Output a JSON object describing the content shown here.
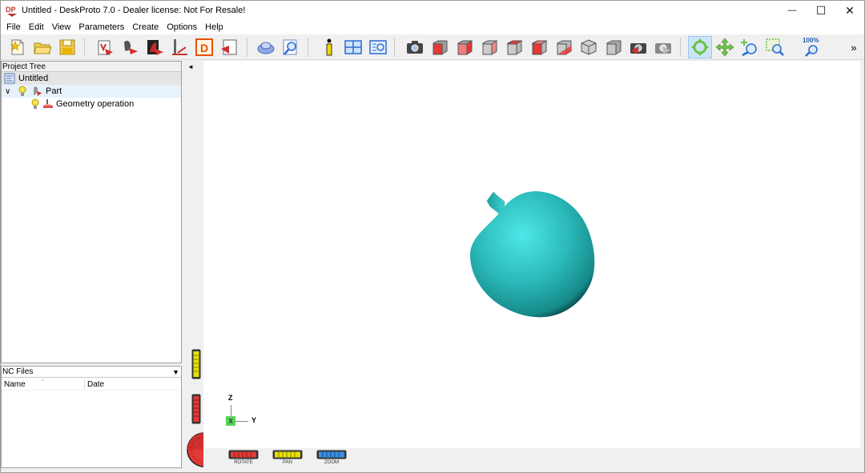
{
  "window": {
    "title": "Untitled - DeskProto 7.0 - Dealer license: Not For Resale!",
    "app_icon_text": "DP",
    "minimize_glyph": "—",
    "maximize_glyph": "☐",
    "close_glyph": "✕"
  },
  "menu": {
    "items": [
      "File",
      "Edit",
      "View",
      "Parameters",
      "Create",
      "Options",
      "Help"
    ]
  },
  "toolbar": {
    "zoom_label": "100%",
    "overflow_glyph": "»",
    "icons": [
      "new-icon",
      "open-icon",
      "save-icon",
      "part-properties-icon",
      "part-geometry-icon",
      "machine-icon",
      "cutter-icon",
      "drawing-icon",
      "nc-output-icon",
      "render-icon",
      "find-icon",
      "info-icon",
      "window-layout-icon",
      "view-settings-icon",
      "camera-icon",
      "view-front-icon",
      "view-right-icon",
      "view-back-icon",
      "view-left-icon",
      "view-top-icon",
      "view-bottom-icon",
      "view-iso-icon",
      "view-solid-icon",
      "undo-view-icon",
      "redo-view-icon",
      "rotate-mode-icon",
      "pan-mode-icon",
      "zoom-mode-icon",
      "zoom-window-icon",
      "zoom-fit-icon"
    ],
    "active_icon": "rotate-mode-icon"
  },
  "project_tree": {
    "header": "Project Tree",
    "root": "Untitled",
    "part": "Part",
    "operation": "Geometry operation",
    "expander_glyph": "∨"
  },
  "nc_files": {
    "header": "NC Files",
    "dropdown_glyph": "▼",
    "col_name": "Name",
    "col_date": "Date"
  },
  "viewport": {
    "axis_z": "Z",
    "axis_y": "Y",
    "axis_x_marker": "X",
    "collapse_glyph": "◄",
    "model_color": "#2ab7b7",
    "labels": {
      "rotate": "ROTATE",
      "pan": "PAN",
      "zoom": "ZOOM"
    }
  }
}
